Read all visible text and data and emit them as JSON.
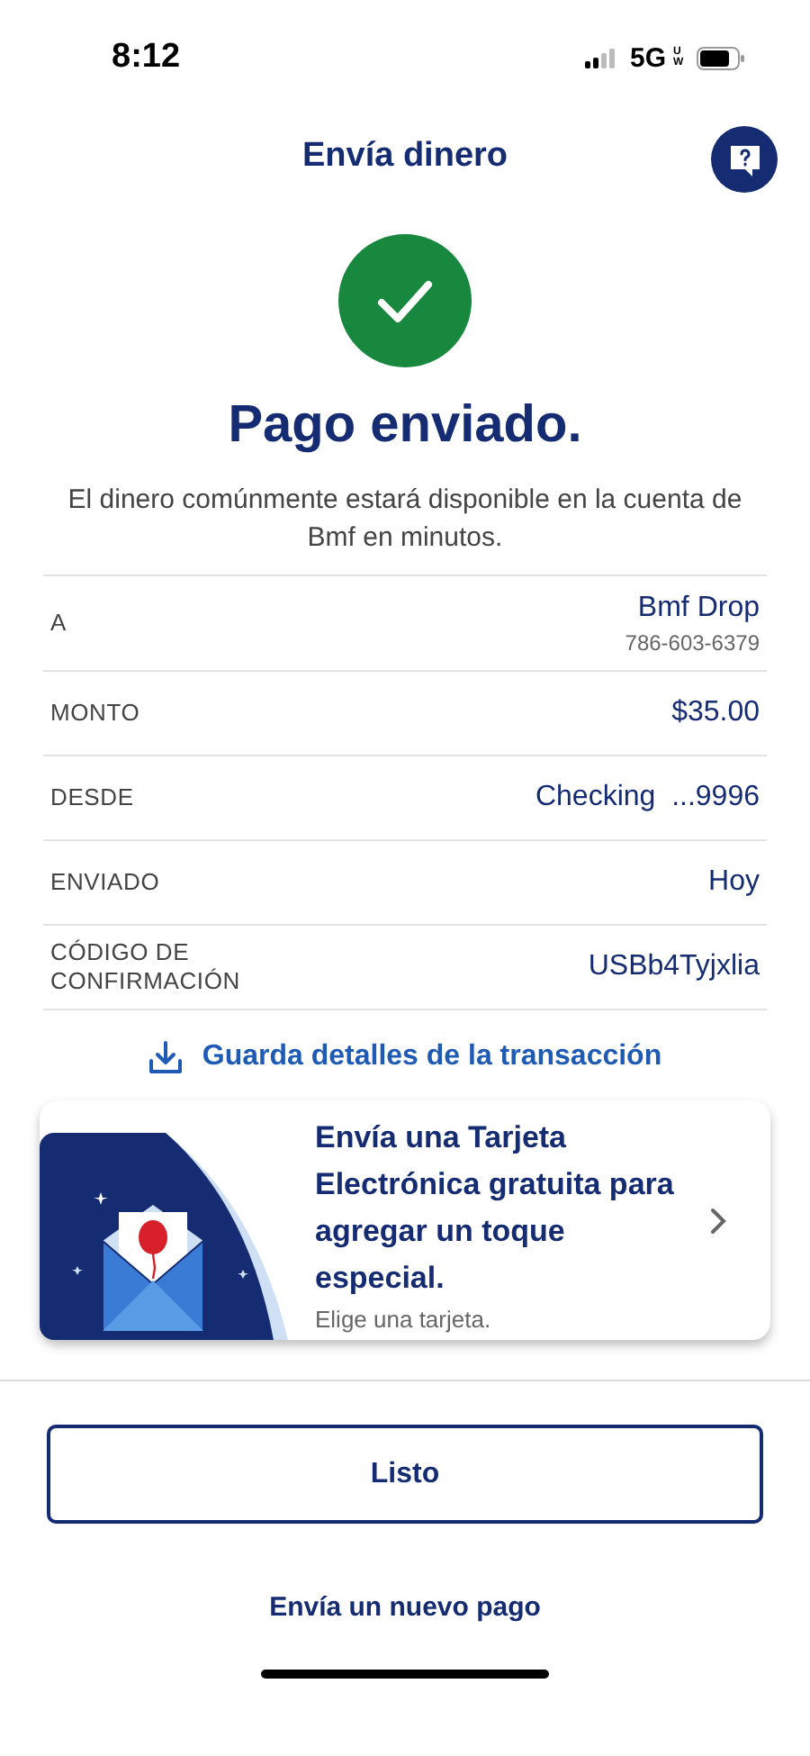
{
  "status_bar": {
    "time": "8:12",
    "network": "5G",
    "network_suffix": "UW"
  },
  "header": {
    "title": "Envía dinero"
  },
  "result": {
    "title": "Pago enviado.",
    "message": "El dinero comúnmente estará disponible en la cuenta de Bmf en minutos."
  },
  "details": [
    {
      "label": "A",
      "value": "Bmf Drop",
      "subvalue": "786-603-6379"
    },
    {
      "label": "MONTO",
      "value": "$35.00"
    },
    {
      "label": "DESDE",
      "value": "Checking  ...9996"
    },
    {
      "label": "ENVIADO",
      "value": "Hoy"
    },
    {
      "label": "CÓDIGO DE CONFIRMACIÓN",
      "value": "USBb4Tyjxlia"
    }
  ],
  "save_link": "Guarda detalles de la transacción",
  "promo": {
    "title": "Envía una Tarjeta Electrónica gratuita para agregar un toque especial.",
    "subtitle": "Elige una tarjeta."
  },
  "buttons": {
    "primary": "Listo",
    "secondary": "Envía un nuevo pago"
  }
}
